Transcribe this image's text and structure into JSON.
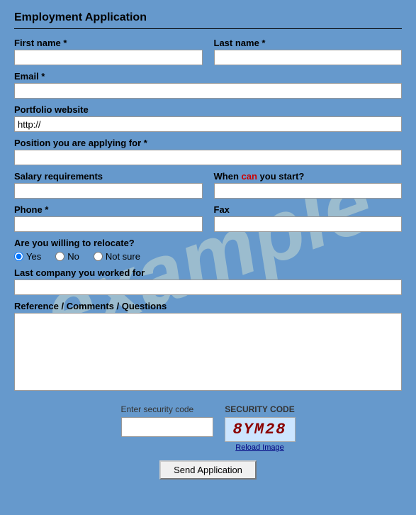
{
  "page": {
    "title": "Employment Application",
    "watermark": "example"
  },
  "fields": {
    "first_name_label": "First name *",
    "last_name_label": "Last name *",
    "email_label": "Email *",
    "portfolio_label": "Portfolio website",
    "portfolio_placeholder": "http://",
    "position_label": "Position you are applying for *",
    "salary_label": "Salary requirements",
    "when_start_label_before": "When ",
    "when_start_label_highlight": "can",
    "when_start_label_after": " you start?",
    "phone_label": "Phone *",
    "fax_label": "Fax",
    "relocate_label": "Are you willing to relocate?",
    "relocate_yes": "Yes",
    "relocate_no": "No",
    "relocate_not_sure": "Not sure",
    "last_company_label": "Last company you worked for",
    "comments_label": "Reference / Comments / Questions"
  },
  "security": {
    "enter_label": "Enter security code",
    "code_label": "SECURITY CODE",
    "code_value": "8YM28",
    "reload_label": "Reload Image"
  },
  "buttons": {
    "submit_label": "Send Application"
  }
}
